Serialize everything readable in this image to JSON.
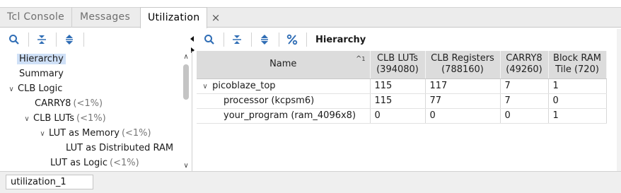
{
  "tabs": [
    {
      "label": "Tcl Console"
    },
    {
      "label": "Messages"
    },
    {
      "label": "Utilization"
    }
  ],
  "right_toolbar": {
    "title": "Hierarchy"
  },
  "tree": {
    "items": [
      {
        "label": "Hierarchy",
        "pct": ""
      },
      {
        "label": "Summary",
        "pct": ""
      },
      {
        "label": "CLB Logic",
        "pct": ""
      },
      {
        "label": "CARRY8",
        "pct": "(<1%)"
      },
      {
        "label": "CLB LUTs",
        "pct": "(<1%)"
      },
      {
        "label": "LUT as Memory",
        "pct": "(<1%)"
      },
      {
        "label": "LUT as Distributed RAM",
        "pct": ""
      },
      {
        "label": "LUT as Logic",
        "pct": "(<1%)"
      }
    ]
  },
  "table": {
    "headers": [
      "Name",
      "CLB LUTs",
      "(394080)",
      "CLB Registers",
      "(788160)",
      "CARRY8",
      "(49260)",
      "Block RAM",
      "Tile (720)"
    ],
    "sort_index": "1",
    "rows": [
      {
        "name": "picoblaze_top",
        "luts": "115",
        "regs": "117",
        "carry": "7",
        "bram": "1"
      },
      {
        "name": "processor (kcpsm6)",
        "luts": "115",
        "regs": "77",
        "carry": "7",
        "bram": "0"
      },
      {
        "name": "your_program (ram_4096x8)",
        "luts": "0",
        "regs": "0",
        "carry": "0",
        "bram": "1"
      }
    ]
  },
  "footer": {
    "name": "utilization_1"
  },
  "colors": {
    "selection": "#cfe0f7",
    "header_bg": "#dcdcdc",
    "icon_blue": "#2f6db5"
  }
}
